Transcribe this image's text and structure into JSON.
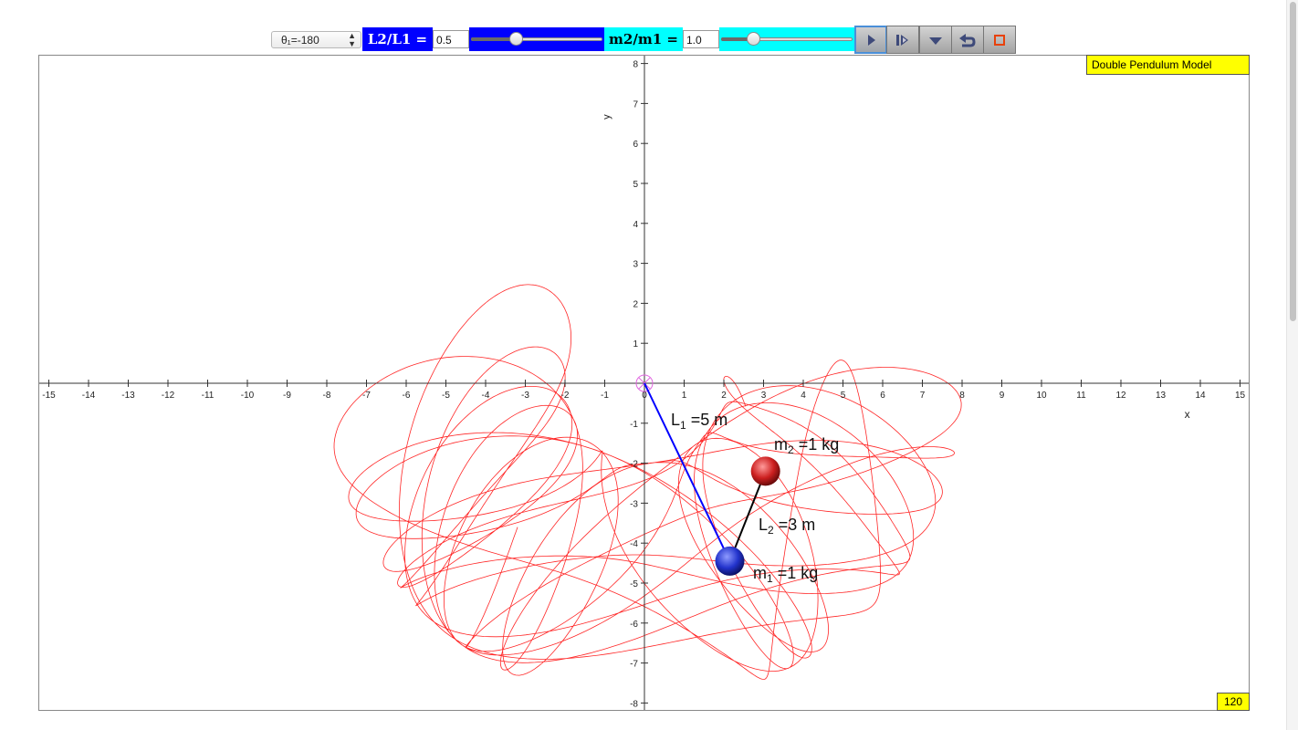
{
  "toolbar": {
    "theta_select": "θ₁=-180",
    "ratio_L_label": "L2/L1 =",
    "ratio_L_value": "0.5",
    "ratio_L_slider": 0.35,
    "ratio_m_label": "m2/m1 =",
    "ratio_m_value": "1.0",
    "ratio_m_slider": 0.25,
    "colors": {
      "L_label_bg": "#0000ff",
      "m_label_bg": "#00ffff",
      "L_slider_bg": "#0000ff",
      "m_slider_bg": "#00ffff"
    },
    "buttons": [
      {
        "name": "play",
        "icon": "play-icon",
        "active": true
      },
      {
        "name": "step",
        "icon": "step-forward-icon",
        "active": false
      },
      {
        "name": "menu",
        "icon": "dropdown-icon",
        "active": false
      },
      {
        "name": "reset",
        "icon": "reset-icon",
        "active": false
      },
      {
        "name": "stop",
        "icon": "stop-icon",
        "active": false
      }
    ]
  },
  "plot": {
    "title": "Double Pendulum Model",
    "counter": "120",
    "x_axis_label": "x",
    "y_axis_label": "y",
    "xlim": [
      -15,
      15
    ],
    "ylim": [
      -8,
      8
    ],
    "x_ticks": [
      -15,
      -14,
      -13,
      -12,
      -11,
      -10,
      -9,
      -8,
      -7,
      -6,
      -5,
      -4,
      -3,
      -2,
      -1,
      0,
      1,
      2,
      3,
      4,
      5,
      6,
      7,
      8,
      9,
      10,
      11,
      12,
      13,
      14,
      15
    ],
    "y_ticks": [
      -8,
      -7,
      -6,
      -5,
      -4,
      -3,
      -2,
      -1,
      1,
      2,
      3,
      4,
      5,
      6,
      7,
      8
    ],
    "pivot": [
      0,
      0
    ],
    "mass1": {
      "x": 2.15,
      "y": -4.45,
      "color": "#2233cc"
    },
    "mass2": {
      "x": 3.05,
      "y": -2.2,
      "color": "#cc1f1f"
    },
    "rod1_color": "#0000ff",
    "rod2_color": "#000000",
    "trace_color": "#ff0000",
    "labels": {
      "L1": {
        "prefix": "L",
        "sub": "1",
        "text": " =5 m"
      },
      "L2": {
        "prefix": "L",
        "sub": "2",
        "text": " =3 m"
      },
      "m1": {
        "prefix": "m",
        "sub": "1",
        "text": " =1 kg"
      },
      "m2": {
        "prefix": "m",
        "sub": "2",
        "text": " =1 kg"
      }
    }
  }
}
